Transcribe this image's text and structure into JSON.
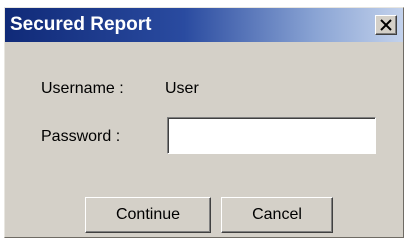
{
  "window": {
    "title": "Secured Report",
    "close_icon": "close-icon"
  },
  "form": {
    "username_label": "Username :",
    "username_value": "User",
    "password_label": "Password :",
    "password_value": "",
    "password_placeholder": ""
  },
  "buttons": {
    "continue_label": "Continue",
    "cancel_label": "Cancel"
  },
  "colors": {
    "title_gradient_start": "#102a78",
    "title_gradient_end": "#c3d2ec",
    "dialog_background": "#d4d0c8"
  }
}
